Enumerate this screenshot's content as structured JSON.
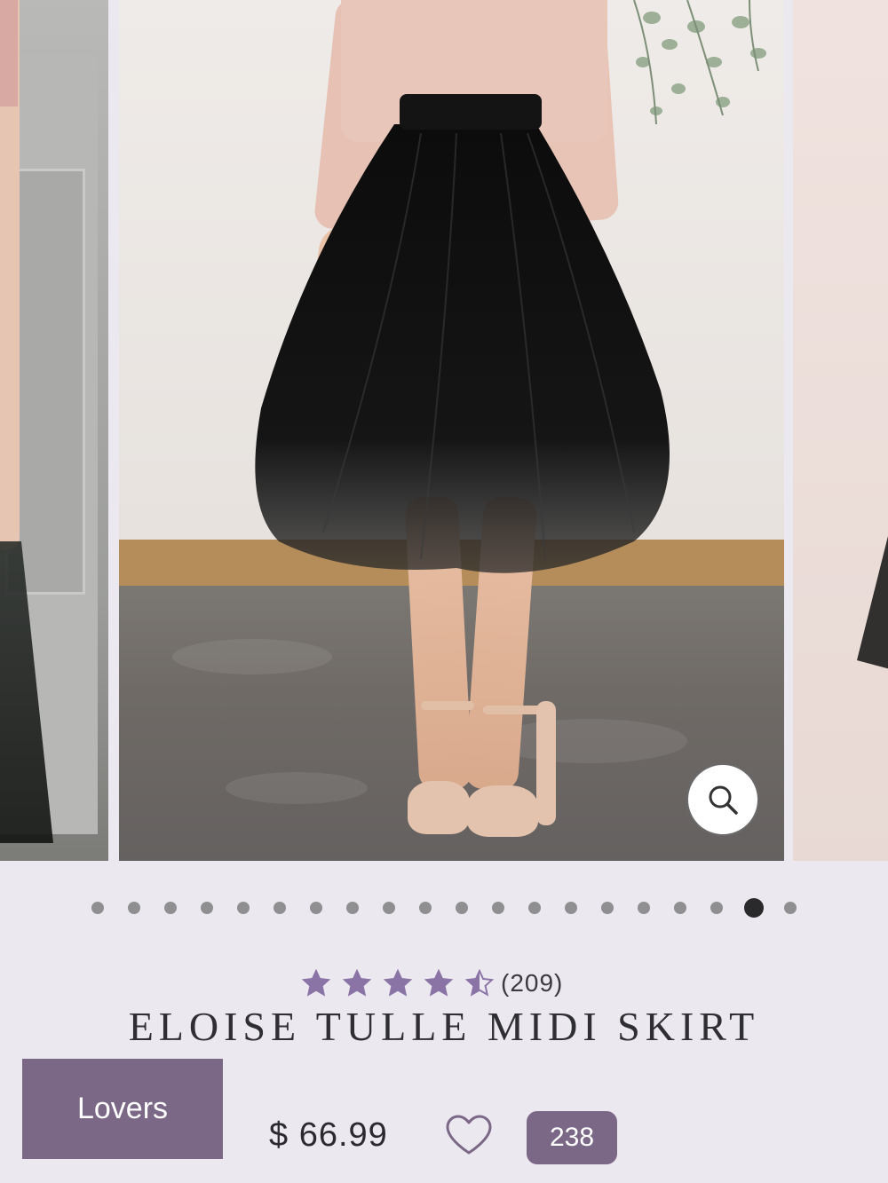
{
  "product": {
    "title": "ELOISE TULLE MIDI SKIRT",
    "rating": 4.5,
    "rating_max": 5,
    "review_count": "(209)",
    "price": "$ 66.99",
    "like_count": "238"
  },
  "carousel": {
    "total_slides": 20,
    "active_index": 18,
    "zoom_icon": "magnifier-icon"
  },
  "actions": {
    "lovers_label": "Lovers",
    "heart_icon": "heart-outline-icon"
  },
  "colors": {
    "accent": "#7b6887",
    "star": "#8a74a6",
    "background": "#ece8f0",
    "text": "#2f2f33"
  }
}
